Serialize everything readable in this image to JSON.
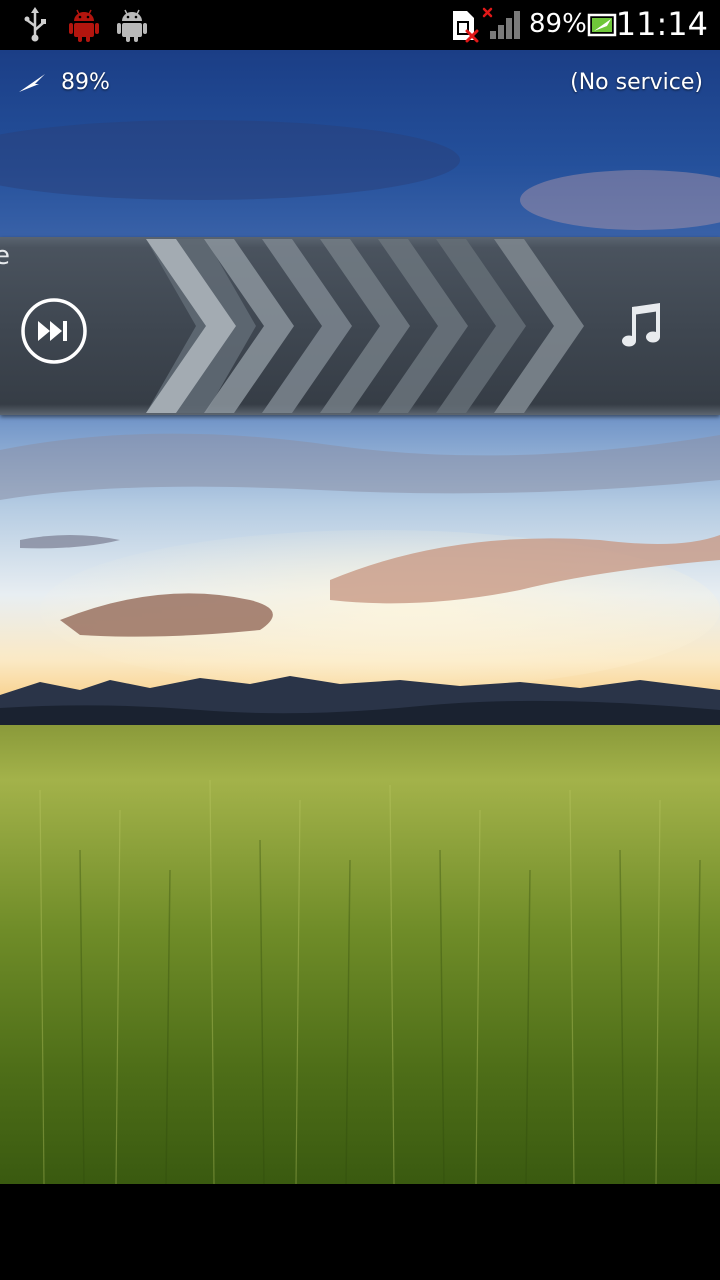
{
  "status_bar": {
    "time": "11:14",
    "battery_percent": "89%",
    "icons": [
      "usb-icon",
      "android-debug-icon",
      "android-icon",
      "sim-missing-icon",
      "signal-no-service-icon",
      "battery-charging-icon"
    ]
  },
  "lockscreen": {
    "charging_percent": "89%",
    "network_status": "(No service)",
    "bar_partial_text": "e"
  },
  "colors": {
    "bar_base": "#3f4751",
    "chevron_light": "#8f989f",
    "debug_icon_red": "#b3150e"
  }
}
